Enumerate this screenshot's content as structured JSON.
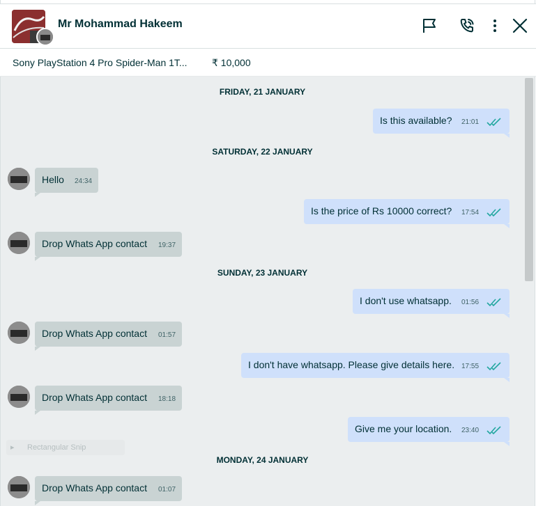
{
  "header": {
    "contact_name": "Mr Mohammad Hakeem",
    "icons": [
      "flag-icon",
      "phone-call-icon",
      "more-vertical-icon",
      "close-icon"
    ]
  },
  "listing": {
    "title": "Sony PlayStation 4 Pro Spider-Man 1T...",
    "price": "₹ 10,000"
  },
  "chat": {
    "days": [
      "FRIDAY, 21 JANUARY",
      "SATURDAY, 22 JANUARY",
      "SUNDAY, 23 JANUARY",
      "MONDAY, 24 JANUARY"
    ],
    "messages": [
      {
        "dir": "out",
        "text": "Is this available?",
        "time": "21:01"
      },
      {
        "dir": "in",
        "text": "Hello",
        "time": "24:34"
      },
      {
        "dir": "out",
        "text": "Is the price of Rs 10000 correct?",
        "time": "17:54"
      },
      {
        "dir": "in",
        "text": "Drop Whats App contact",
        "time": "19:37"
      },
      {
        "dir": "out",
        "text": "I don't use whatsapp.",
        "time": "01:56"
      },
      {
        "dir": "in",
        "text": "Drop Whats App contact",
        "time": "01:57"
      },
      {
        "dir": "out",
        "text": "I don't have whatsapp. Please give details here.",
        "time": "17:55"
      },
      {
        "dir": "in",
        "text": "Drop Whats App contact",
        "time": "18:18"
      },
      {
        "dir": "out",
        "text": "Give me your location.",
        "time": "23:40"
      },
      {
        "dir": "in",
        "text": "Drop Whats App contact",
        "time": "01:07"
      }
    ],
    "faint_overlay": "Rectangular Snip"
  },
  "colors": {
    "outgoing_bubble": "#cfe0fb",
    "incoming_bubble": "#c9d3d3",
    "chat_bg": "#ebeeef",
    "read_tick": "#23a7a0"
  }
}
